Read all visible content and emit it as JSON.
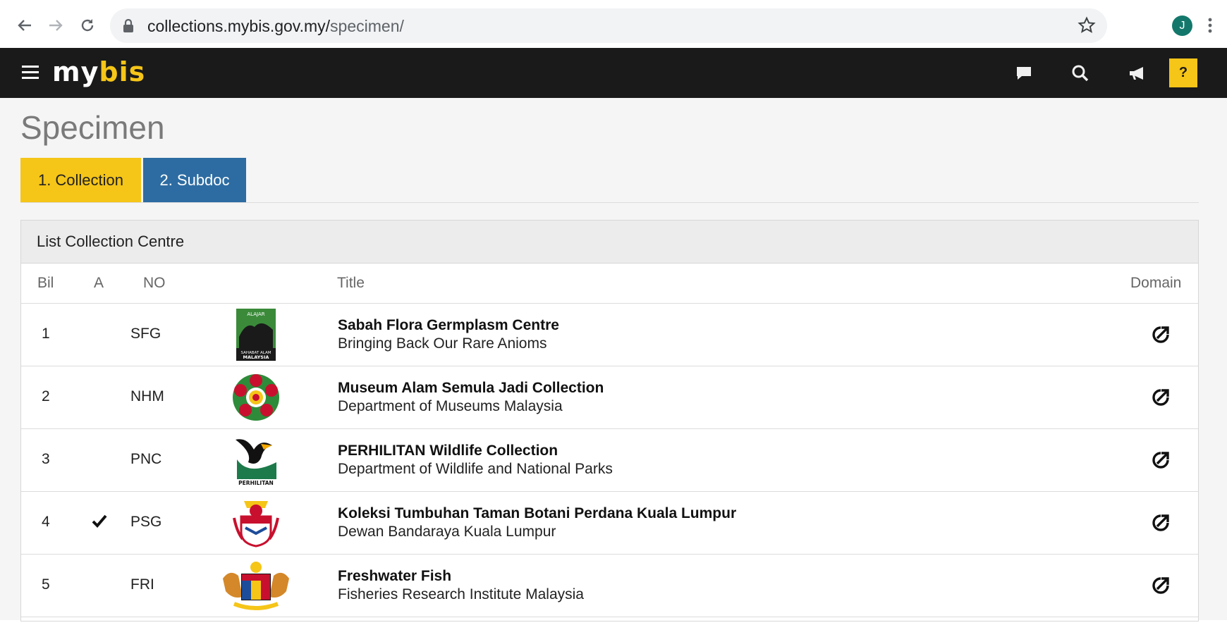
{
  "browser": {
    "url_host": "collections.mybis.gov.my/",
    "url_path": "specimen/",
    "profile_initial": "J"
  },
  "header": {
    "logo_my": "my",
    "logo_bis": "bis",
    "help_label": "?"
  },
  "page": {
    "title": "Specimen",
    "tabs": [
      {
        "label": "1. Collection",
        "active": true
      },
      {
        "label": "2. Subdoc",
        "active": false
      }
    ]
  },
  "panel": {
    "heading": "List Collection Centre",
    "columns": {
      "bil": "Bil",
      "a": "A",
      "no": "NO",
      "title": "Title",
      "domain": "Domain"
    },
    "rows": [
      {
        "bil": "1",
        "a": "",
        "no": "SFG",
        "title": "Sabah Flora Germplasm Centre",
        "subtitle": "Bringing Back Our Rare Anioms",
        "logo": "sahabat-alam-malaysia-logo",
        "logo_text_top": "ALAJAR",
        "logo_text_bottom": "SAHABAT ALAM",
        "logo_text_bottom2": "MALAYSIA"
      },
      {
        "bil": "2",
        "a": "",
        "no": "NHM",
        "title": "Museum Alam Semula Jadi Collection",
        "subtitle": "Department of Museums Malaysia",
        "logo": "jabatan-muzium-logo"
      },
      {
        "bil": "3",
        "a": "",
        "no": "PNC",
        "title": "PERHILITAN Wildlife Collection",
        "subtitle": "Department of Wildlife and National Parks",
        "logo": "perhilitan-logo",
        "logo_text": "PERHILITAN"
      },
      {
        "bil": "4",
        "a": "check",
        "no": "PSG",
        "title": "Koleksi Tumbuhan Taman Botani Perdana Kuala Lumpur",
        "subtitle": "Dewan Bandaraya Kuala Lumpur",
        "logo": "dbkl-crest-logo"
      },
      {
        "bil": "5",
        "a": "",
        "no": "FRI",
        "title": "Freshwater Fish",
        "subtitle": "Fisheries Research Institute Malaysia",
        "logo": "malaysia-coat-of-arms-logo"
      }
    ]
  },
  "colors": {
    "header_bg": "#1a1a1a",
    "accent_yellow": "#f5c518",
    "tab_blue": "#2d6ca2",
    "content_bg": "#f5f5f5"
  }
}
